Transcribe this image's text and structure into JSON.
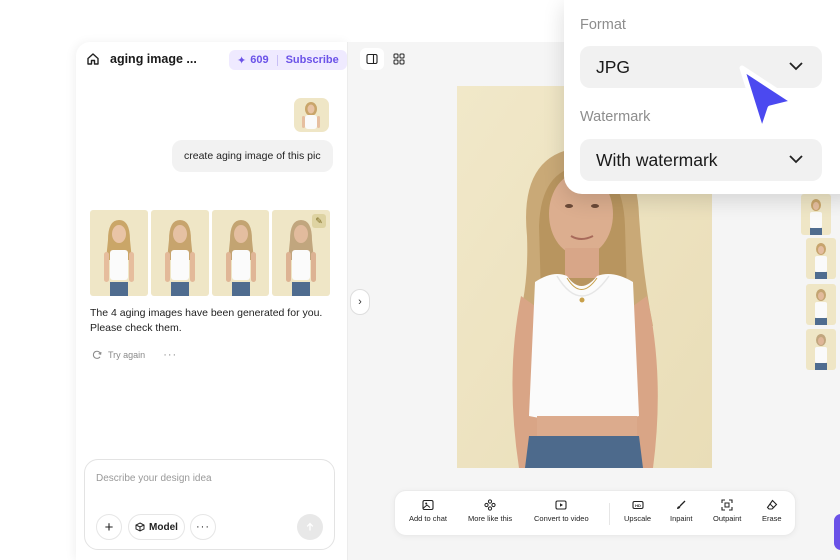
{
  "chat": {
    "title": "aging image ...",
    "credits": "609",
    "subscribe": "Subscribe",
    "user_message": "create aging image of this pic",
    "result_text": "The 4 aging images have been generated for you. Please check them.",
    "retry": "Try again",
    "more": "···",
    "composer_placeholder": "Describe your design idea",
    "model_label": "Model",
    "plus": "+",
    "dots": "···"
  },
  "toolbar": {
    "add_to_chat": "Add to chat",
    "more_like_this": "More like this",
    "convert_to_video": "Convert to video",
    "upscale": "Upscale",
    "inpaint": "Inpaint",
    "outpaint": "Outpaint",
    "erase": "Erase"
  },
  "popover": {
    "format_label": "Format",
    "format_value": "JPG",
    "watermark_label": "Watermark",
    "watermark_value": "With watermark"
  },
  "colors": {
    "accent": "#6b52e8",
    "cursor": "#4b49f0",
    "photo_bg": "#efe6c6"
  },
  "icons": {
    "home": "home-icon",
    "sparkle": "sparkle-icon",
    "chevron": "chevron-down-icon",
    "cursor": "pointer-cursor-icon"
  }
}
